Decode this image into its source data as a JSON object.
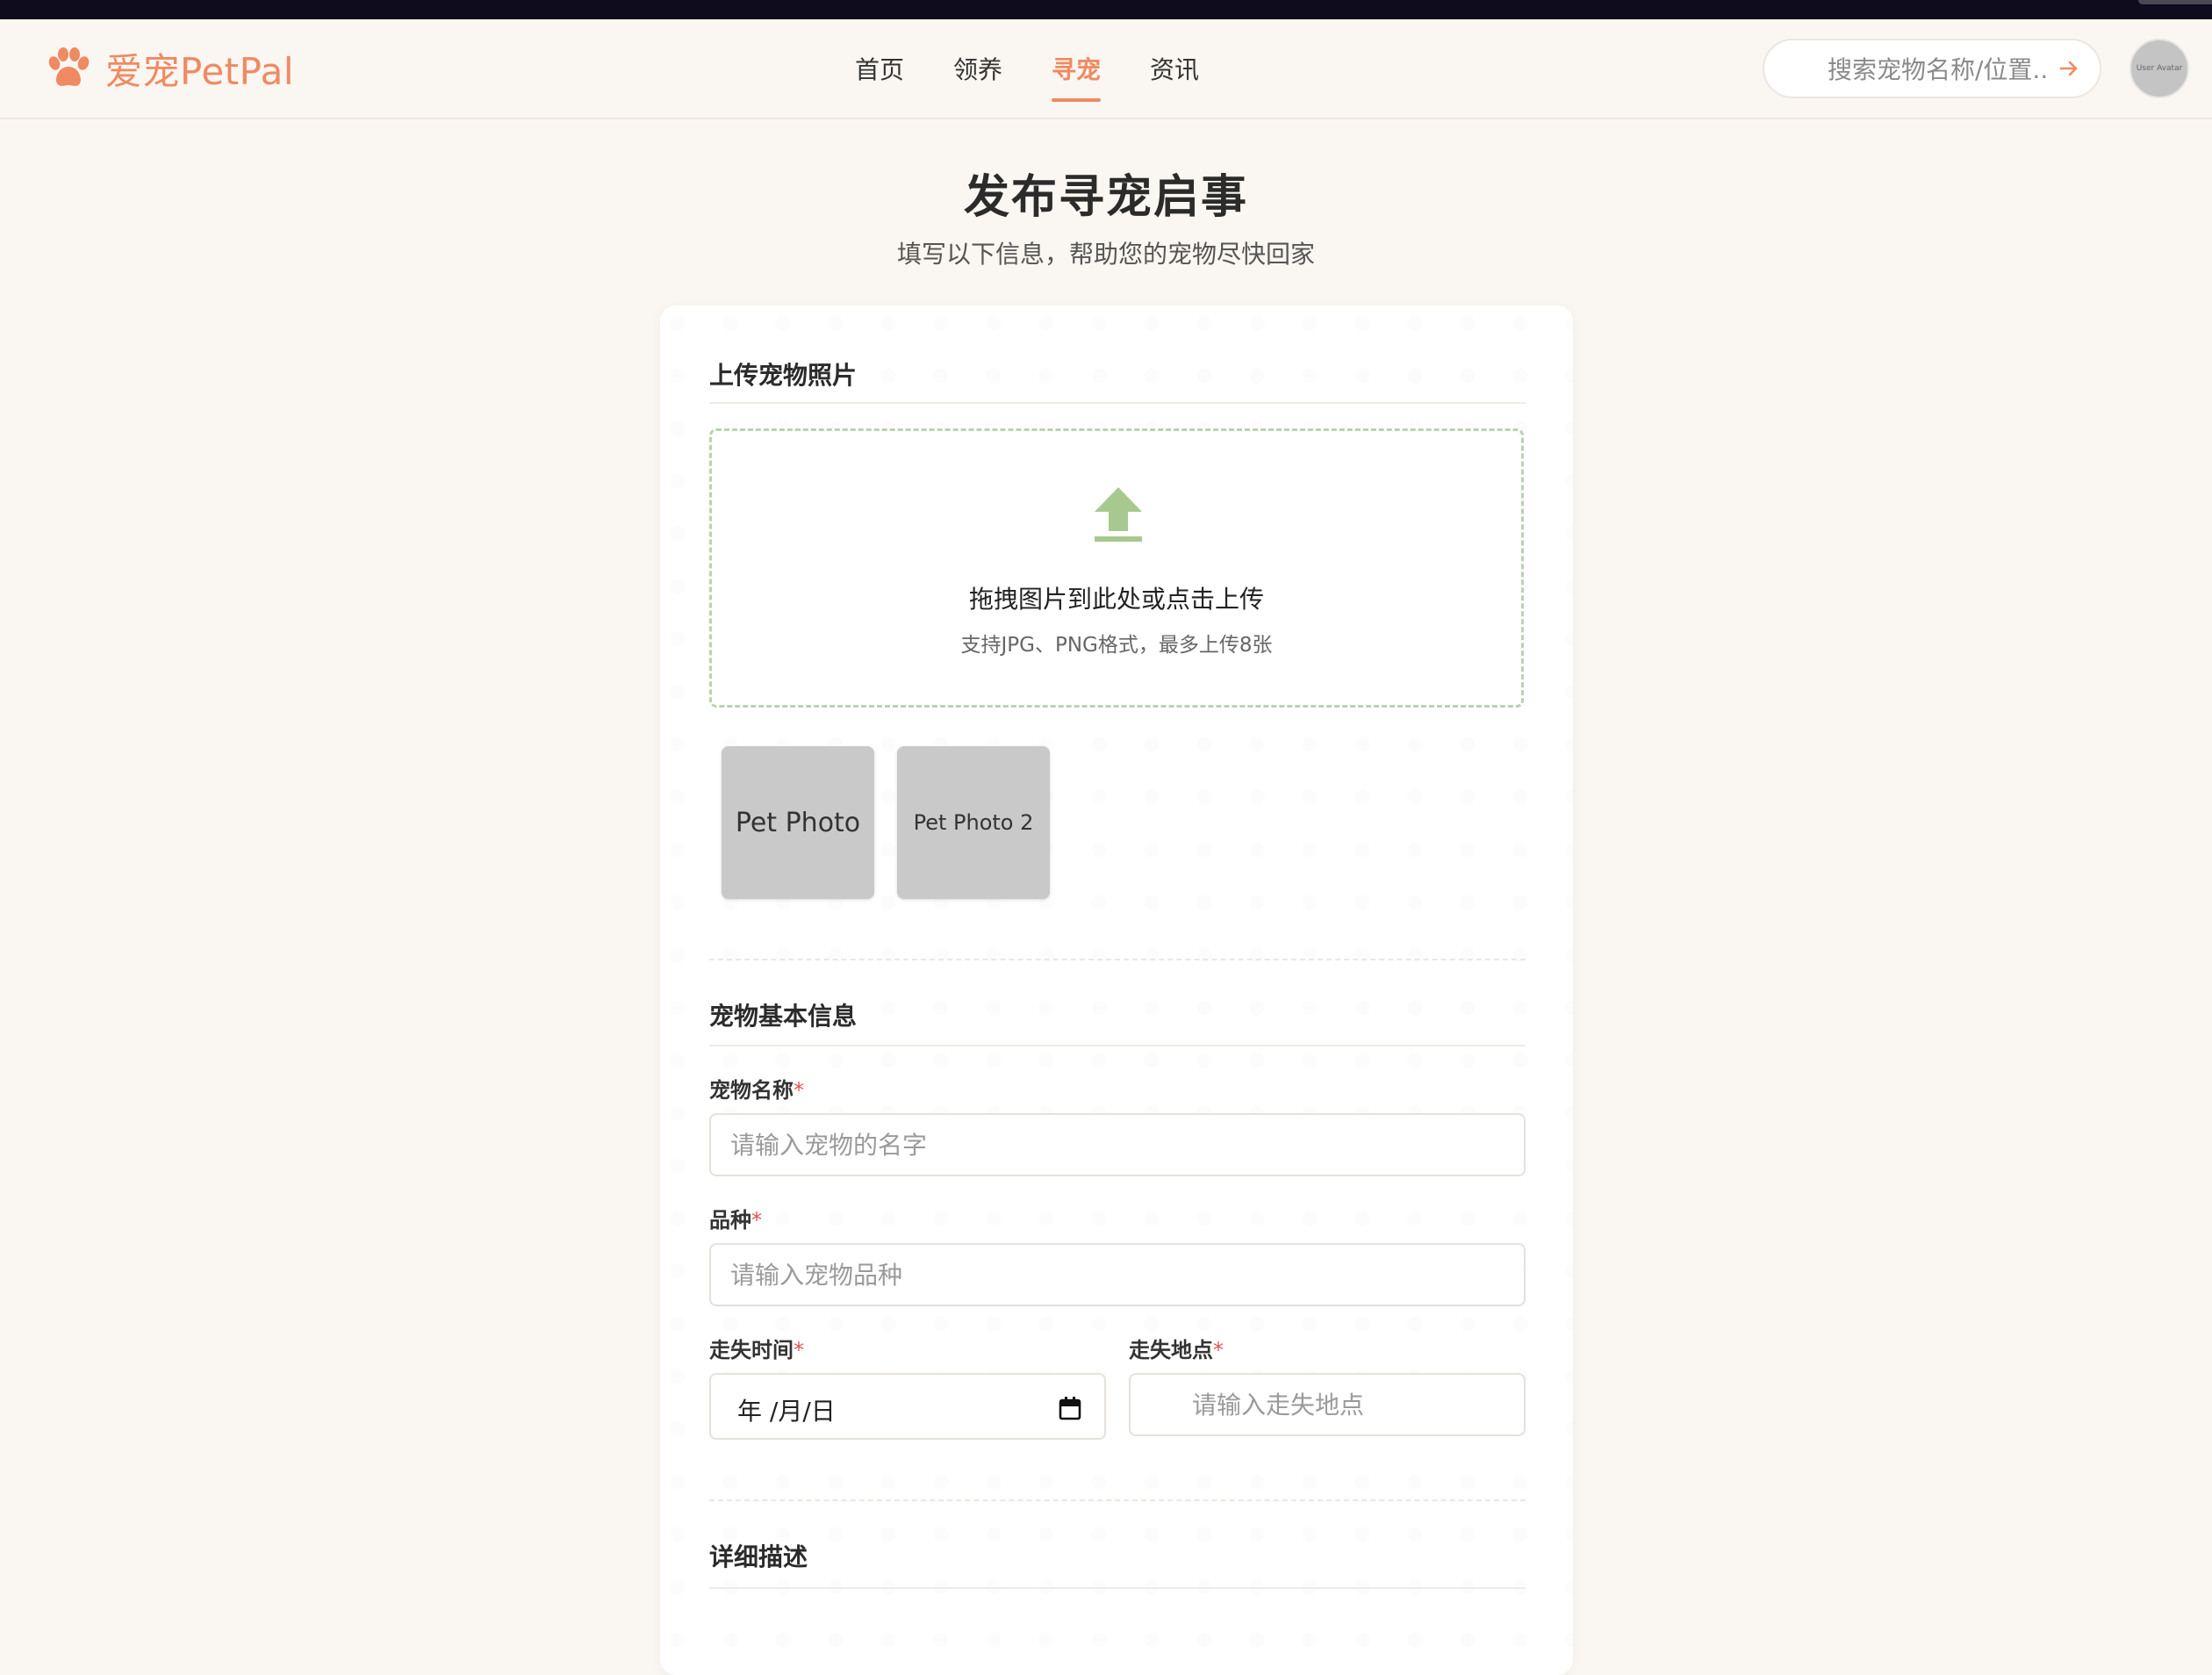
{
  "brand": {
    "logo_text": "爱宠PetPal",
    "accent": "#ef8a62"
  },
  "nav": {
    "items": [
      "首页",
      "领养",
      "寻宠",
      "资讯"
    ],
    "active_index": 2
  },
  "search": {
    "placeholder": "搜索宠物名称/位置..."
  },
  "avatar": {
    "alt": "User Avatar"
  },
  "page": {
    "title": "发布寻宠启事",
    "subtitle": "填写以下信息，帮助您的宠物尽快回家"
  },
  "upload": {
    "section_title": "上传宠物照片",
    "drop_title": "拖拽图片到此处或点击上传",
    "drop_hint": "支持JPG、PNG格式，最多上传8张",
    "icon": "upload-icon",
    "photos": [
      "Pet Photo",
      "Pet Photo 2"
    ]
  },
  "basic": {
    "section_title": "宠物基本信息",
    "name_label": "宠物名称",
    "name_placeholder": "请输入宠物的名字",
    "breed_label": "品种",
    "breed_placeholder": "请输入宠物品种",
    "lost_time_label": "走失时间",
    "lost_time_value": "年 /月/日",
    "lost_location_label": "走失地点",
    "lost_location_placeholder": "请输入走失地点",
    "required_mark": "*"
  },
  "detail": {
    "section_title": "详细描述"
  },
  "colors": {
    "accent": "#ef8a62",
    "upload_green": "#a7c98f",
    "required": "#e05353",
    "background": "#faf6f1"
  }
}
